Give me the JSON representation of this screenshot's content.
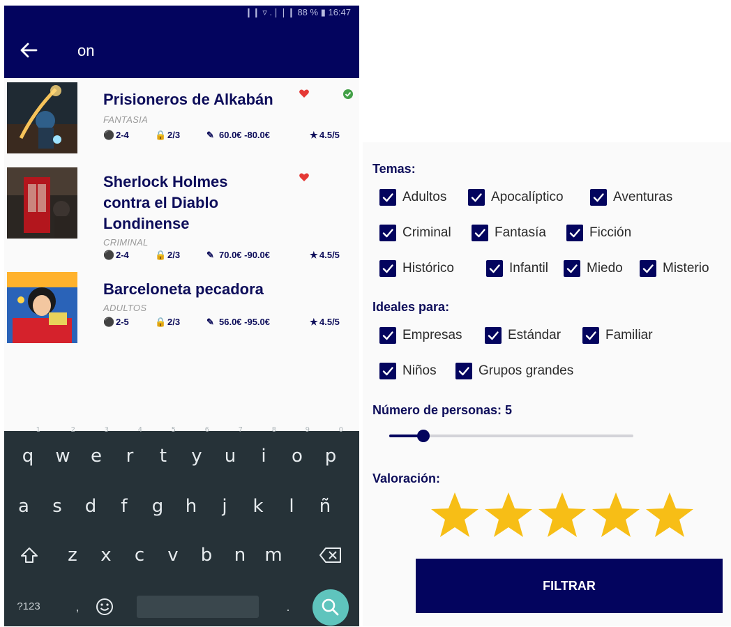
{
  "status_bar": {
    "text": "❙❙ ▿ .❘❘❙ 88 % ▮ 16:47"
  },
  "search": {
    "query": "on"
  },
  "results": [
    {
      "title": "Prisioneros de Alkabán",
      "genre": "FANTASIA",
      "players": "2-4",
      "difficulty": "2/3",
      "price": "60.0€ -80.0€",
      "rating": "4.5/5",
      "favorite": true,
      "completed": true
    },
    {
      "title": "Sherlock Holmes contra el Diablo Londinense",
      "genre": "CRIMINAL",
      "players": "2-4",
      "difficulty": "2/3",
      "price": "70.0€ -90.0€",
      "rating": "4.5/5",
      "favorite": true,
      "completed": false
    },
    {
      "title": "Barceloneta pecadora",
      "genre": "ADULTOS",
      "players": "2-5",
      "difficulty": "2/3",
      "price": "56.0€ -95.0€",
      "rating": "4.5/5",
      "favorite": false,
      "completed": false
    }
  ],
  "keyboard": {
    "row1": [
      {
        "k": "q",
        "n": "1"
      },
      {
        "k": "w",
        "n": "2"
      },
      {
        "k": "e",
        "n": "3"
      },
      {
        "k": "r",
        "n": "4"
      },
      {
        "k": "t",
        "n": "5"
      },
      {
        "k": "y",
        "n": "6"
      },
      {
        "k": "u",
        "n": "7"
      },
      {
        "k": "i",
        "n": "8"
      },
      {
        "k": "o",
        "n": "9"
      },
      {
        "k": "p",
        "n": "0"
      }
    ],
    "row2": [
      "a",
      "s",
      "d",
      "f",
      "g",
      "h",
      "j",
      "k",
      "l",
      "ñ"
    ],
    "row3": [
      "z",
      "x",
      "c",
      "v",
      "b",
      "n",
      "m"
    ],
    "symbols_label": "?123",
    "comma": ",",
    "dot": "."
  },
  "filters": {
    "themes_heading": "Temas:",
    "themes": [
      {
        "label": "Adultos",
        "checked": true
      },
      {
        "label": "Apocalíptico",
        "checked": true
      },
      {
        "label": "Aventuras",
        "checked": true
      },
      {
        "label": "Criminal",
        "checked": true
      },
      {
        "label": "Fantasía",
        "checked": true
      },
      {
        "label": "Ficción",
        "checked": true
      },
      {
        "label": "Histórico",
        "checked": true
      },
      {
        "label": "Infantil",
        "checked": true
      },
      {
        "label": "Miedo",
        "checked": true
      },
      {
        "label": "Misterio",
        "checked": true
      }
    ],
    "ideal_heading": "Ideales para:",
    "ideal": [
      {
        "label": "Empresas",
        "checked": true
      },
      {
        "label": "Estándar",
        "checked": true
      },
      {
        "label": "Familiar",
        "checked": true
      },
      {
        "label": "Niños",
        "checked": true
      },
      {
        "label": "Grupos grandes",
        "checked": true
      }
    ],
    "people_heading": "Número de personas: 5",
    "people_slider_fraction": 0.14,
    "rating_heading": "Valoración:",
    "rating_value": 5,
    "rating_max": 5,
    "button_label": "FILTRAR"
  },
  "colors": {
    "navy": "#03045e",
    "title": "#0d0d5a",
    "star": "#f7be16",
    "heart": "#e53935",
    "check": "#43a047",
    "keyboard_bg": "#263238",
    "search_key": "#5fc4bd"
  }
}
